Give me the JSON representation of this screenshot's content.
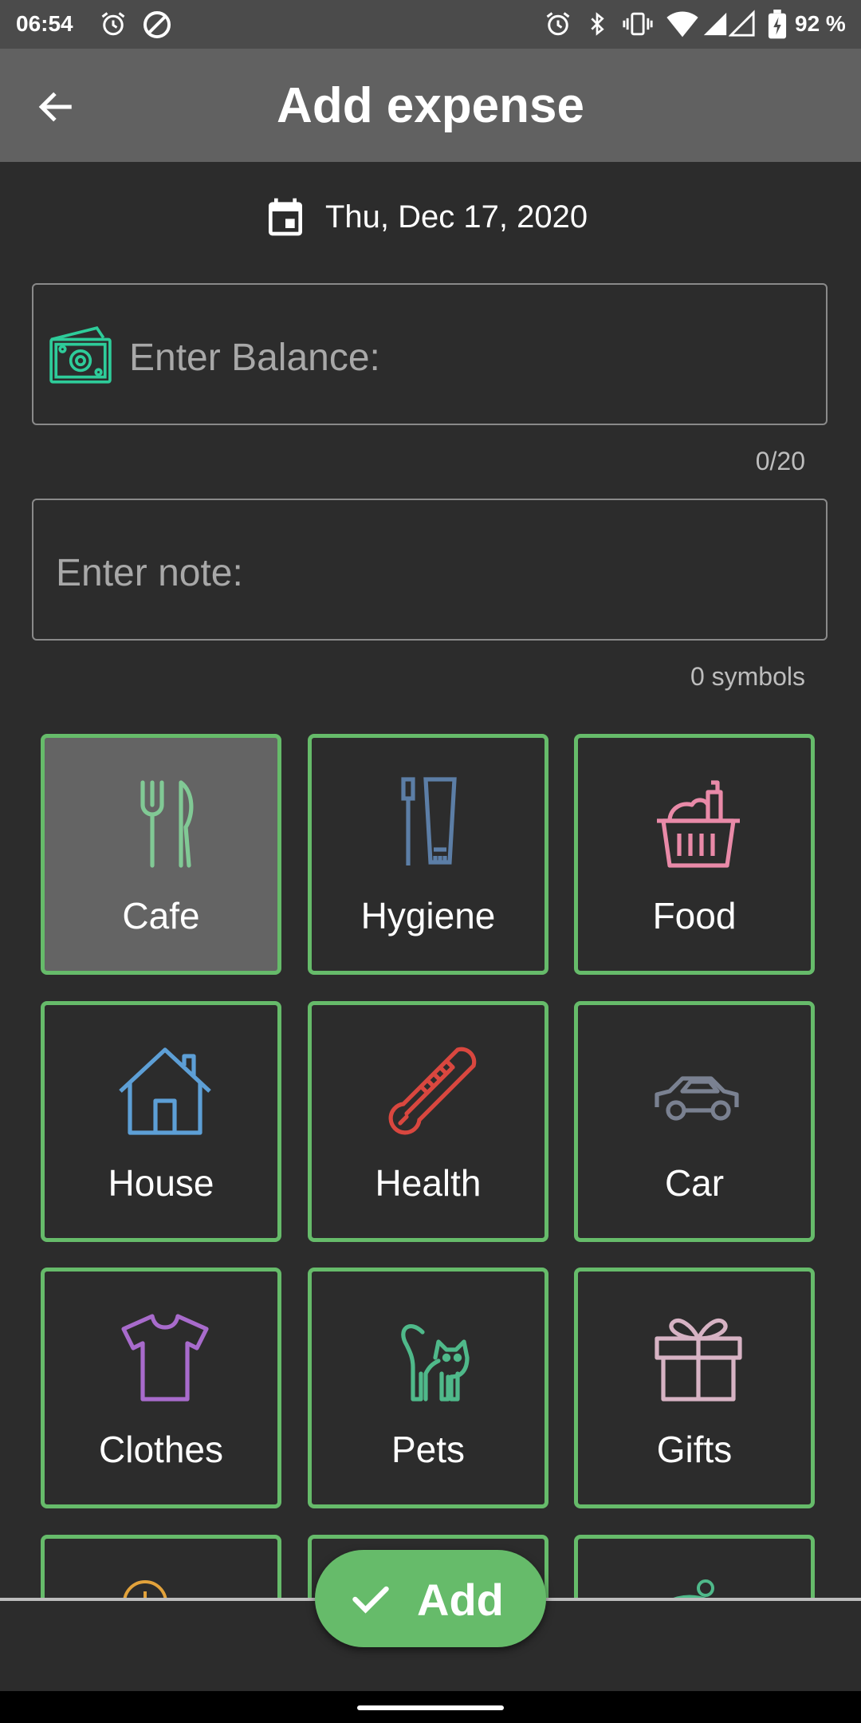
{
  "status_bar": {
    "time": "06:54",
    "battery": "92 %"
  },
  "app_bar": {
    "title": "Add expense"
  },
  "date": {
    "text": "Thu, Dec 17, 2020"
  },
  "balance_field": {
    "placeholder": "Enter Balance:",
    "counter": "0/20"
  },
  "note_field": {
    "placeholder": "Enter note:",
    "counter": "0 symbols"
  },
  "categories": [
    {
      "label": "Cafe",
      "icon": "cafe-icon",
      "color": "#81c995",
      "selected": true
    },
    {
      "label": "Hygiene",
      "icon": "hygiene-icon",
      "color": "#5c7ea6",
      "selected": false
    },
    {
      "label": "Food",
      "icon": "food-icon",
      "color": "#e98aa8",
      "selected": false
    },
    {
      "label": "House",
      "icon": "house-icon",
      "color": "#5d9fd6",
      "selected": false
    },
    {
      "label": "Health",
      "icon": "thermometer-icon",
      "color": "#d9473f",
      "selected": false
    },
    {
      "label": "Car",
      "icon": "car-icon",
      "color": "#7a8191",
      "selected": false
    },
    {
      "label": "Clothes",
      "icon": "tshirt-icon",
      "color": "#a86bcc",
      "selected": false
    },
    {
      "label": "Pets",
      "icon": "cat-icon",
      "color": "#4fb98a",
      "selected": false
    },
    {
      "label": "Gifts",
      "icon": "gift-icon",
      "color": "#d7b3c4",
      "selected": false
    }
  ],
  "fab": {
    "label": "Add"
  },
  "colors": {
    "accent": "#66bb6a",
    "background": "#2c2c2c",
    "app_bar": "#616161",
    "status_bar": "#4b4b4b"
  }
}
